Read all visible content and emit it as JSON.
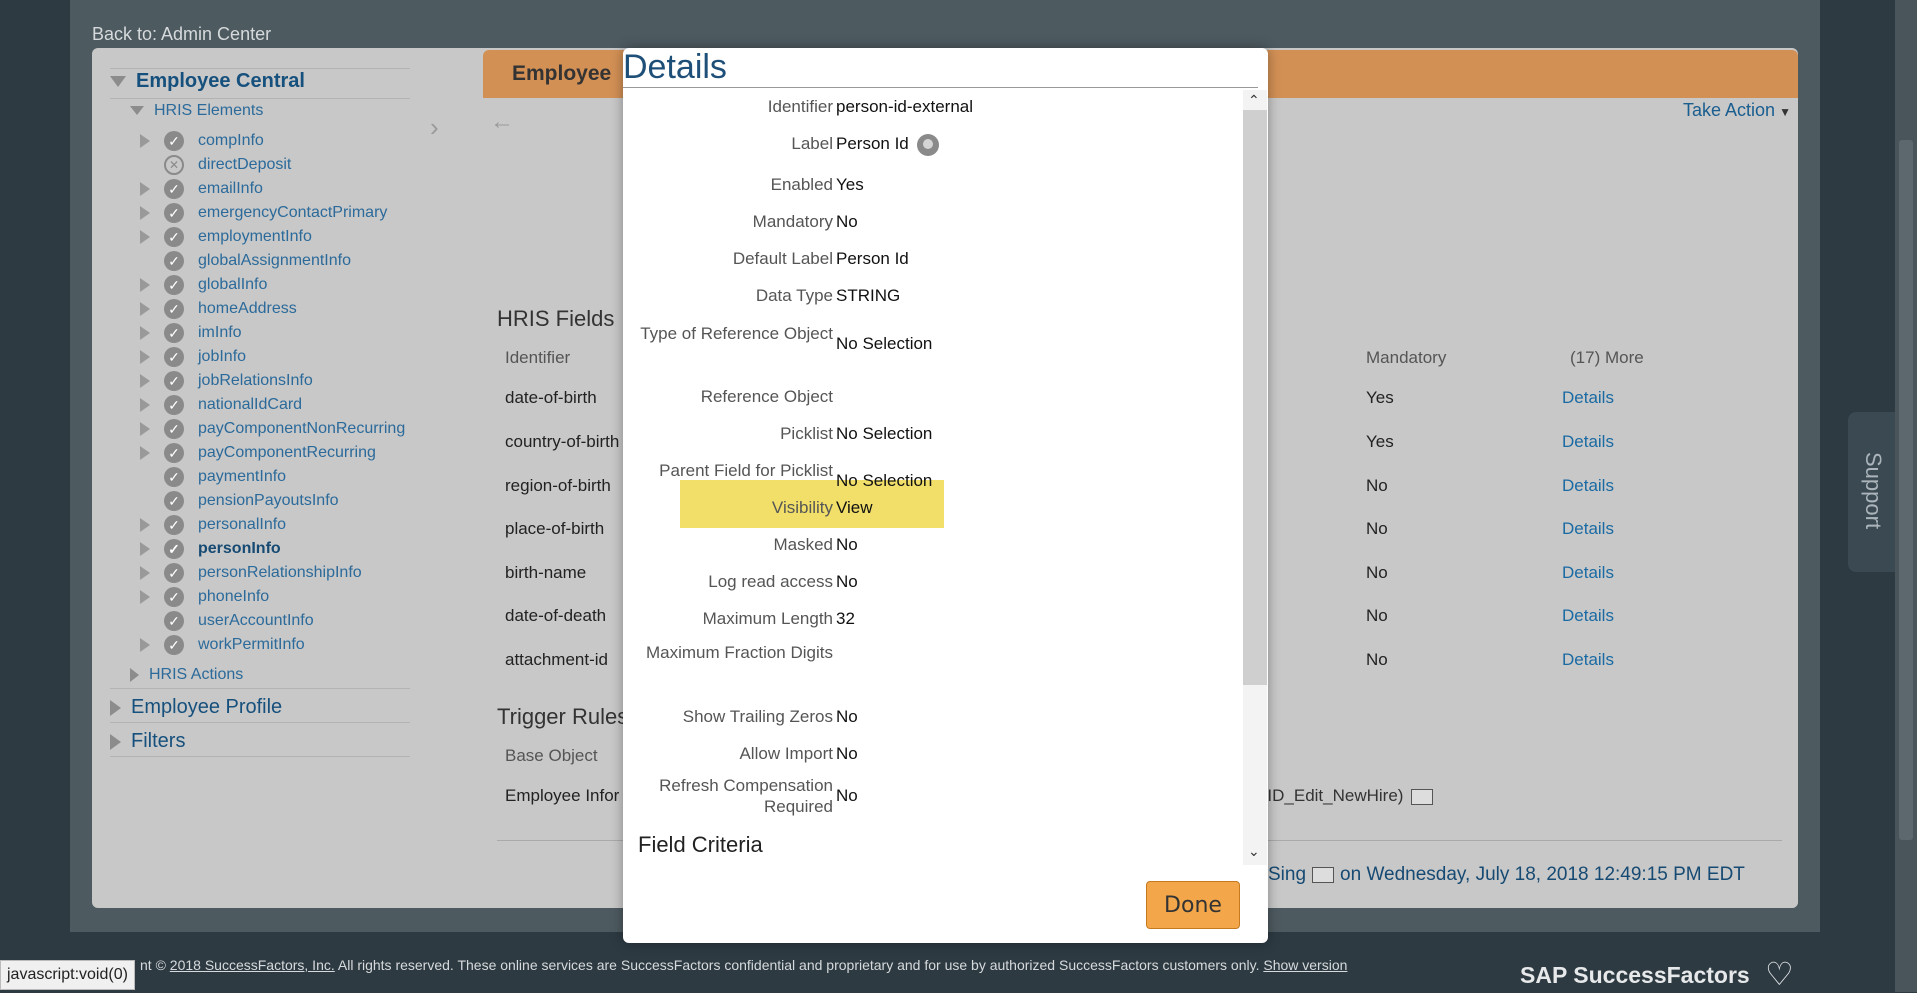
{
  "back_link": "Back to: Admin Center",
  "left_nav": {
    "section_employee_central": "Employee Central",
    "hris_elements": "HRIS Elements",
    "tree_items": [
      {
        "label": "compInfo",
        "expandable": true,
        "status": "check"
      },
      {
        "label": "directDeposit",
        "expandable": false,
        "status": "x"
      },
      {
        "label": "emailInfo",
        "expandable": true,
        "status": "check"
      },
      {
        "label": "emergencyContactPrimary",
        "expandable": true,
        "status": "check"
      },
      {
        "label": "employmentInfo",
        "expandable": true,
        "status": "check"
      },
      {
        "label": "globalAssignmentInfo",
        "expandable": false,
        "status": "check"
      },
      {
        "label": "globalInfo",
        "expandable": true,
        "status": "check"
      },
      {
        "label": "homeAddress",
        "expandable": true,
        "status": "check"
      },
      {
        "label": "imInfo",
        "expandable": true,
        "status": "check"
      },
      {
        "label": "jobInfo",
        "expandable": true,
        "status": "check"
      },
      {
        "label": "jobRelationsInfo",
        "expandable": true,
        "status": "check"
      },
      {
        "label": "nationalIdCard",
        "expandable": true,
        "status": "check"
      },
      {
        "label": "payComponentNonRecurring",
        "expandable": true,
        "status": "check"
      },
      {
        "label": "payComponentRecurring",
        "expandable": true,
        "status": "check"
      },
      {
        "label": "paymentInfo",
        "expandable": false,
        "status": "check"
      },
      {
        "label": "pensionPayoutsInfo",
        "expandable": false,
        "status": "check"
      },
      {
        "label": "personalInfo",
        "expandable": true,
        "status": "check"
      },
      {
        "label": "personInfo",
        "expandable": true,
        "status": "check",
        "selected": true
      },
      {
        "label": "personRelationshipInfo",
        "expandable": true,
        "status": "check"
      },
      {
        "label": "phoneInfo",
        "expandable": true,
        "status": "check"
      },
      {
        "label": "userAccountInfo",
        "expandable": false,
        "status": "check"
      },
      {
        "label": "workPermitInfo",
        "expandable": true,
        "status": "check"
      }
    ],
    "hris_actions": "HRIS Actions",
    "section_employee_profile": "Employee Profile",
    "section_filters": "Filters"
  },
  "panel": {
    "title": "Employee",
    "take_action": "Take Action",
    "hris_fields_title": "HRIS Fields",
    "columns": {
      "identifier": "Identifier",
      "mandatory": "Mandatory",
      "more": "(17) More"
    },
    "rows": [
      {
        "id": "date-of-birth",
        "mandatory": "Yes",
        "details": "Details"
      },
      {
        "id": "country-of-birth",
        "mandatory": "Yes",
        "details": "Details"
      },
      {
        "id": "region-of-birth",
        "mandatory": "No",
        "details": "Details"
      },
      {
        "id": "place-of-birth",
        "mandatory": "No",
        "details": "Details"
      },
      {
        "id": "birth-name",
        "mandatory": "No",
        "details": "Details"
      },
      {
        "id": "date-of-death",
        "mandatory": "No",
        "details": "Details"
      },
      {
        "id": "attachment-id",
        "mandatory": "No",
        "details": "Details"
      }
    ],
    "trigger_rules_title": "Trigger Rules",
    "base_object_header": "Base Object",
    "trigger_base_value": "Employee Infor",
    "trigger_rule_value": "sonID_Edit_NewHire)",
    "modified_by": "Sing",
    "modified_on": "on Wednesday, July 18, 2018 12:49:15 PM EDT"
  },
  "modal": {
    "title": "Details",
    "fields": [
      {
        "label": "Identifier",
        "value": "person-id-external"
      },
      {
        "label": "Label",
        "value": "Person Id"
      },
      {
        "label": "Enabled",
        "value": "Yes"
      },
      {
        "label": "Mandatory",
        "value": "No"
      },
      {
        "label": "Default Label",
        "value": "Person Id"
      },
      {
        "label": "Data Type",
        "value": "STRING"
      },
      {
        "label": "Type of Reference Object",
        "value": "No Selection"
      },
      {
        "label": "Reference Object",
        "value": ""
      },
      {
        "label": "Picklist",
        "value": "No Selection"
      },
      {
        "label": "Parent Field for Picklist",
        "value": "No Selection"
      },
      {
        "label": "Visibility",
        "value": "View"
      },
      {
        "label": "Masked",
        "value": "No"
      },
      {
        "label": "Log read access",
        "value": "No"
      },
      {
        "label": "Maximum Length",
        "value": "32"
      },
      {
        "label": "Maximum Fraction Digits",
        "value": ""
      },
      {
        "label": "Show Trailing Zeros",
        "value": "No"
      },
      {
        "label": "Allow Import",
        "value": "No"
      },
      {
        "label": "Refresh Compensation Required",
        "value": "No"
      }
    ],
    "field_criteria": "Field Criteria",
    "done_label": "Done"
  },
  "support_label": "Support",
  "footer": {
    "prefix": "nt ©",
    "company_link": "2018 SuccessFactors, Inc.",
    "text": "All rights reserved. These online services are SuccessFactors confidential and proprietary and for use by authorized SuccessFactors customers only.",
    "show_version": "Show version"
  },
  "brand": "SAP SuccessFactors",
  "status_bar": "javascript:void(0)",
  "colors": {
    "header_orange": "#d29055",
    "highlight": "#f1df6a",
    "link_blue": "#1a6aa3",
    "done_button": "#f3a74a"
  }
}
